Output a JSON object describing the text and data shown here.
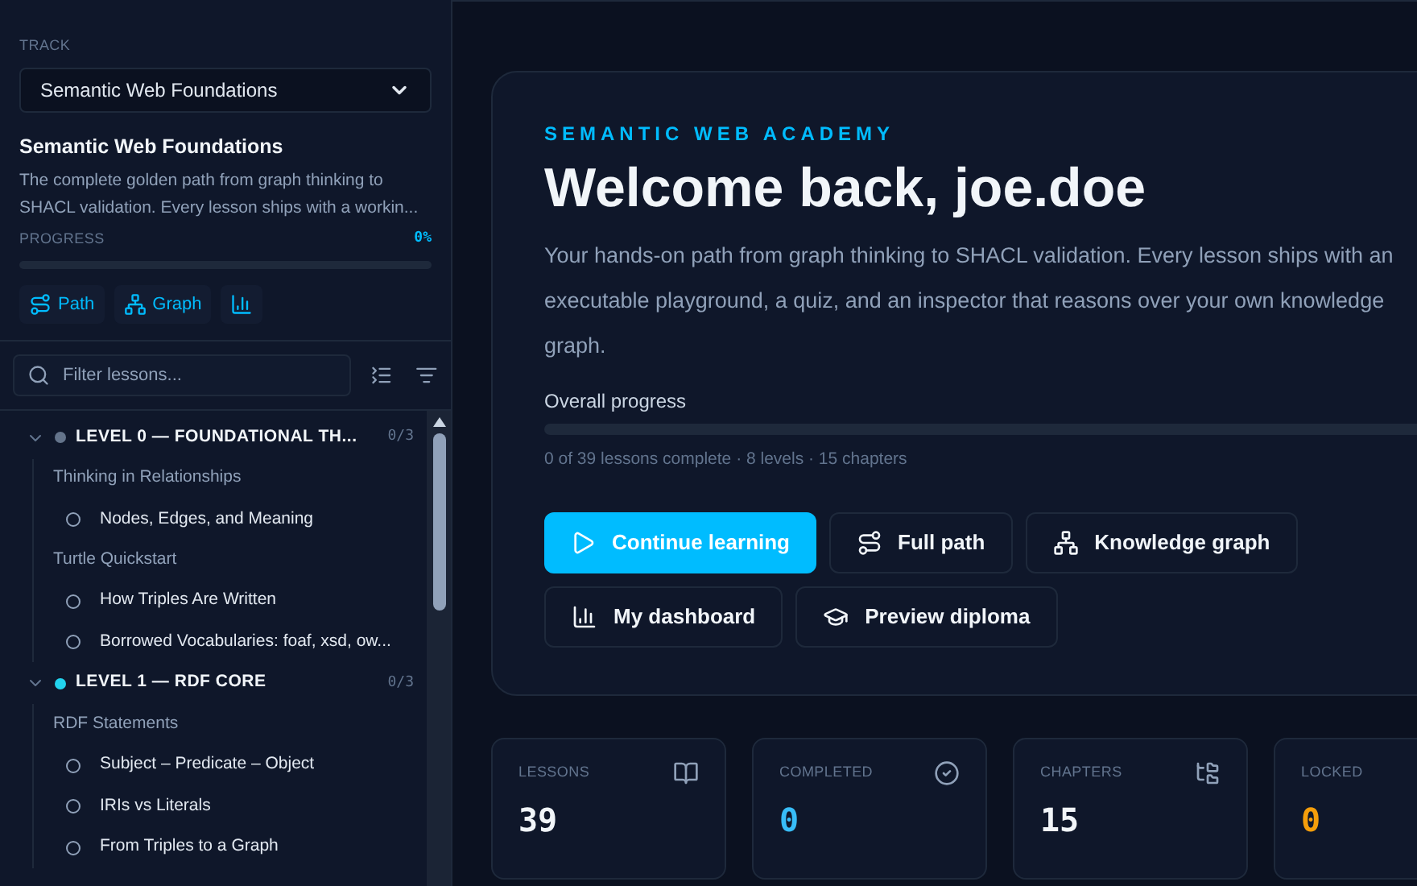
{
  "sidebar": {
    "track_label": "TRACK",
    "track_select": "Semantic Web Foundations",
    "track_title": "Semantic Web Foundations",
    "track_description": "The complete golden path from graph thinking to SHACL validation. Every lesson ships with a workin...",
    "progress_label": "PROGRESS",
    "progress_value": "0%",
    "progress": {
      "level": 0
    },
    "links": [
      {
        "kind": "path",
        "label": "Path"
      },
      {
        "kind": "graph",
        "label": "Graph"
      },
      {
        "kind": "chart"
      }
    ],
    "filter": {
      "placeholder": "Filter lessons..."
    },
    "levels": [
      {
        "title": "LEVEL 0 — FOUNDATIONAL TH...",
        "count": "0/3",
        "color": "#64748b",
        "expanded": true,
        "children": [
          {
            "title": "Thinking in Relationships",
            "children": [
              {
                "title": "Nodes, Edges, and Meaning",
                "completed": false
              }
            ]
          },
          {
            "title": "Turtle Quickstart",
            "children": [
              {
                "title": "How Triples Are Written",
                "completed": false
              },
              {
                "title": "Borrowed Vocabularies: foaf, xsd, ow...",
                "completed": false
              }
            ]
          }
        ]
      },
      {
        "title": "LEVEL 1 — RDF CORE",
        "count": "0/3",
        "color": "#22d3ee",
        "expanded": true,
        "children": [
          {
            "title": "RDF Statements",
            "children": [
              {
                "title": "Subject – Predicate – Object",
                "completed": false
              },
              {
                "title": "IRIs vs Literals",
                "completed": false
              },
              {
                "title": "From Triples to a Graph",
                "completed": false
              }
            ]
          }
        ]
      }
    ]
  },
  "hero": {
    "eyebrow": "SEMANTIC WEB ACADEMY",
    "title": "Welcome back, joe.doe",
    "description": "Your hands-on path from graph thinking to SHACL validation. Every lesson ships with an executable playground, a quiz, and an inspector that reasons over your own knowledge graph.",
    "progress_label": "Overall progress",
    "progress": {
      "level": 0
    },
    "progress_summary": "0 of 39 lessons complete · 8 levels · 15 chapters",
    "buttons": [
      {
        "kind": "play",
        "label": "Continue learning",
        "primary": true
      },
      {
        "kind": "path",
        "label": "Full path",
        "primary": false
      },
      {
        "kind": "graph",
        "label": "Knowledge graph",
        "primary": false
      },
      {
        "kind": "chart",
        "label": "My dashboard",
        "primary": false
      },
      {
        "kind": "diploma",
        "label": "Preview diploma",
        "primary": false
      }
    ]
  },
  "stats": [
    {
      "kind": "book",
      "label": "LESSONS",
      "value": "39",
      "color": "#f1f5f9"
    },
    {
      "kind": "check",
      "label": "COMPLETED",
      "value": "0",
      "color": "#38bdf8"
    },
    {
      "kind": "tree",
      "label": "CHAPTERS",
      "value": "15",
      "color": "#f1f5f9"
    },
    {
      "kind": "none",
      "label": "LOCKED",
      "value": "0",
      "color": "#f59e0b"
    }
  ]
}
